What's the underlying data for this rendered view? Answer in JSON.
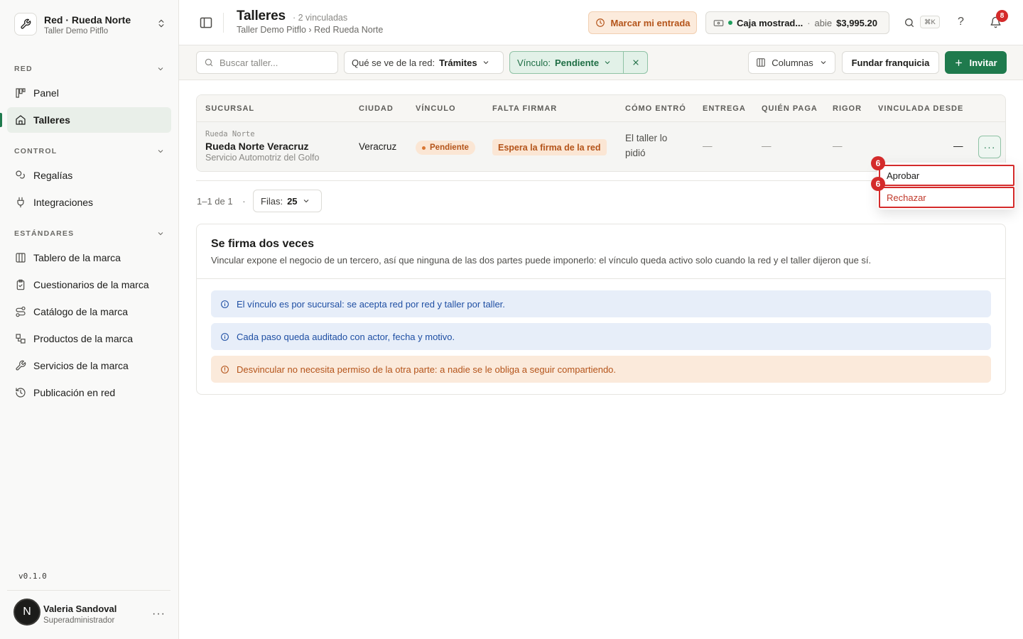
{
  "org": {
    "name": "Red · Rueda Norte",
    "subtitle": "Taller Demo Pitflo"
  },
  "sidebar": {
    "sections": [
      {
        "label": "RED"
      },
      {
        "label": "CONTROL"
      },
      {
        "label": "ESTÁNDARES"
      }
    ],
    "items": [
      {
        "label": "Panel",
        "icon": "chart-icon"
      },
      {
        "label": "Talleres",
        "icon": "home-icon",
        "active": true
      },
      {
        "label": "Regalías",
        "icon": "coins-icon"
      },
      {
        "label": "Integraciones",
        "icon": "plug-icon"
      },
      {
        "label": "Tablero de la marca",
        "icon": "columns-icon"
      },
      {
        "label": "Cuestionarios de la marca",
        "icon": "clipboard-icon"
      },
      {
        "label": "Catálogo de la marca",
        "icon": "route-icon"
      },
      {
        "label": "Productos de la marca",
        "icon": "boxes-icon"
      },
      {
        "label": "Servicios de la marca",
        "icon": "wrench-icon"
      },
      {
        "label": "Publicación en red",
        "icon": "history-icon"
      }
    ],
    "version": "v0.1.0",
    "user": {
      "initial": "N",
      "name": "Valeria Sandoval",
      "role": "Superadministrador"
    }
  },
  "header": {
    "title": "Talleres",
    "count": "· 2 vinculadas",
    "breadcrumb": "Taller Demo Pitflo › Red Rueda Norte",
    "entrada_label": "Marcar mi entrada",
    "caja": {
      "name": "Caja mostrad...",
      "sep": "·",
      "state": "abie",
      "amount": "$3,995.20"
    },
    "kbd": "⌘K",
    "help": "?",
    "notifications": "8"
  },
  "filters": {
    "search_placeholder": "Buscar taller...",
    "red_label": "Qué se ve de la red:",
    "red_value": "Trámites",
    "vinculo_label": "Vínculo:",
    "vinculo_value": "Pendiente",
    "columns_label": "Columnas",
    "fundar_label": "Fundar franquicia",
    "invitar_label": "Invitar"
  },
  "table": {
    "headers": [
      "SUCURSAL",
      "CIUDAD",
      "VÍNCULO",
      "FALTA FIRMAR",
      "CÓMO ENTRÓ",
      "ENTREGA",
      "QUIÉN PAGA",
      "RIGOR",
      "VINCULADA DESDE"
    ],
    "row": {
      "network": "Rueda Norte",
      "name": "Rueda Norte Veracruz",
      "business": "Servicio Automotriz del Golfo",
      "city": "Veracruz",
      "vinculo": "Pendiente",
      "falta_firmar": "Espera la firma de la red",
      "como_entro_1": "El taller lo",
      "como_entro_2": "pidió",
      "entrega": "—",
      "quien_paga": "—",
      "rigor": "—",
      "vinculada_desde": "—",
      "actions": "···"
    }
  },
  "pagination": {
    "range": "1–1 de 1",
    "sep": "·",
    "rows_label": "Filas:",
    "rows_value": "25"
  },
  "menu": {
    "approve": "Aprobar",
    "reject": "Rechazar",
    "badge": "6"
  },
  "info": {
    "title": "Se firma dos veces",
    "description": "Vincular expone el negocio de un tercero, así que ninguna de las dos partes puede imponerlo: el vínculo queda activo solo cuando la red y el taller dijeron que sí.",
    "alerts": [
      {
        "text": "El vínculo es por sucursal: se acepta red por red y taller por taller.",
        "kind": "info"
      },
      {
        "text": "Cada paso queda auditado con actor, fecha y motivo.",
        "kind": "info"
      },
      {
        "text": "Desvincular no necesita permiso de la otra parte: a nadie se le obliga a seguir compartiendo.",
        "kind": "warn"
      }
    ]
  },
  "colors": {
    "accent": "#1f7a4d",
    "warning": "#b4541a",
    "danger": "#d42b2b",
    "info": "#1f4fa3"
  }
}
